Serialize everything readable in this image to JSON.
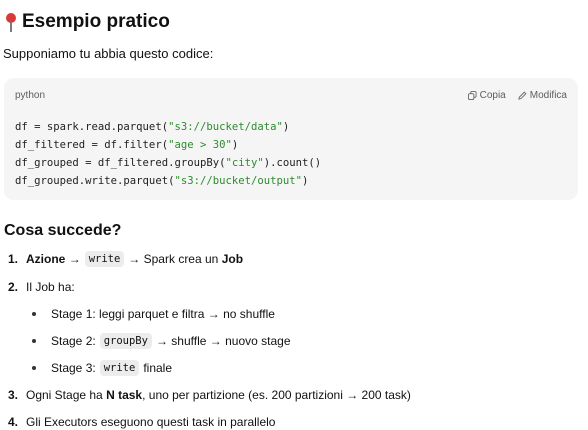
{
  "header": {
    "title": "Esempio pratico",
    "intro": "Supponiamo tu abbia questo codice:"
  },
  "code_block": {
    "language": "python",
    "copy_label": "Copia",
    "edit_label": "Modifica",
    "lines": [
      [
        "df = spark.read.parquet(",
        "\"s3://bucket/data\"",
        ")"
      ],
      [
        "df_filtered = df.filter(",
        "\"age > 30\"",
        ")"
      ],
      [
        "df_grouped = df_filtered.groupBy(",
        "\"city\"",
        ").count()"
      ],
      [
        "df_grouped.write.parquet(",
        "\"s3://bucket/output\"",
        ")"
      ]
    ]
  },
  "section": {
    "title": "Cosa succede?"
  },
  "steps": {
    "s1": {
      "num": "1.",
      "bold": "Azione",
      "arrow1": "→",
      "code": "write",
      "arrow2": "→ Spark crea un",
      "bold2": "Job"
    },
    "s2": {
      "num": "2.",
      "text": "Il Job ha:"
    },
    "b1": {
      "text": "Stage 1: leggi parquet e filtra → no shuffle"
    },
    "b2": {
      "pre": "Stage 2:",
      "code": "groupBy",
      "post": "→ shuffle → nuovo stage"
    },
    "b3": {
      "pre": "Stage 3:",
      "code": "write",
      "post": "finale"
    },
    "s3": {
      "num": "3.",
      "pre": "Ogni Stage ha",
      "bold": "N task",
      "post": ", uno per partizione (es. 200 partizioni → 200 task)"
    },
    "s4": {
      "num": "4.",
      "text": "Gli Executors eseguono questi task in parallelo"
    }
  },
  "colors": {
    "code_string": "#2e8b2e",
    "code_background": "#f5f5f5",
    "pin_head": "#d83a3a"
  }
}
